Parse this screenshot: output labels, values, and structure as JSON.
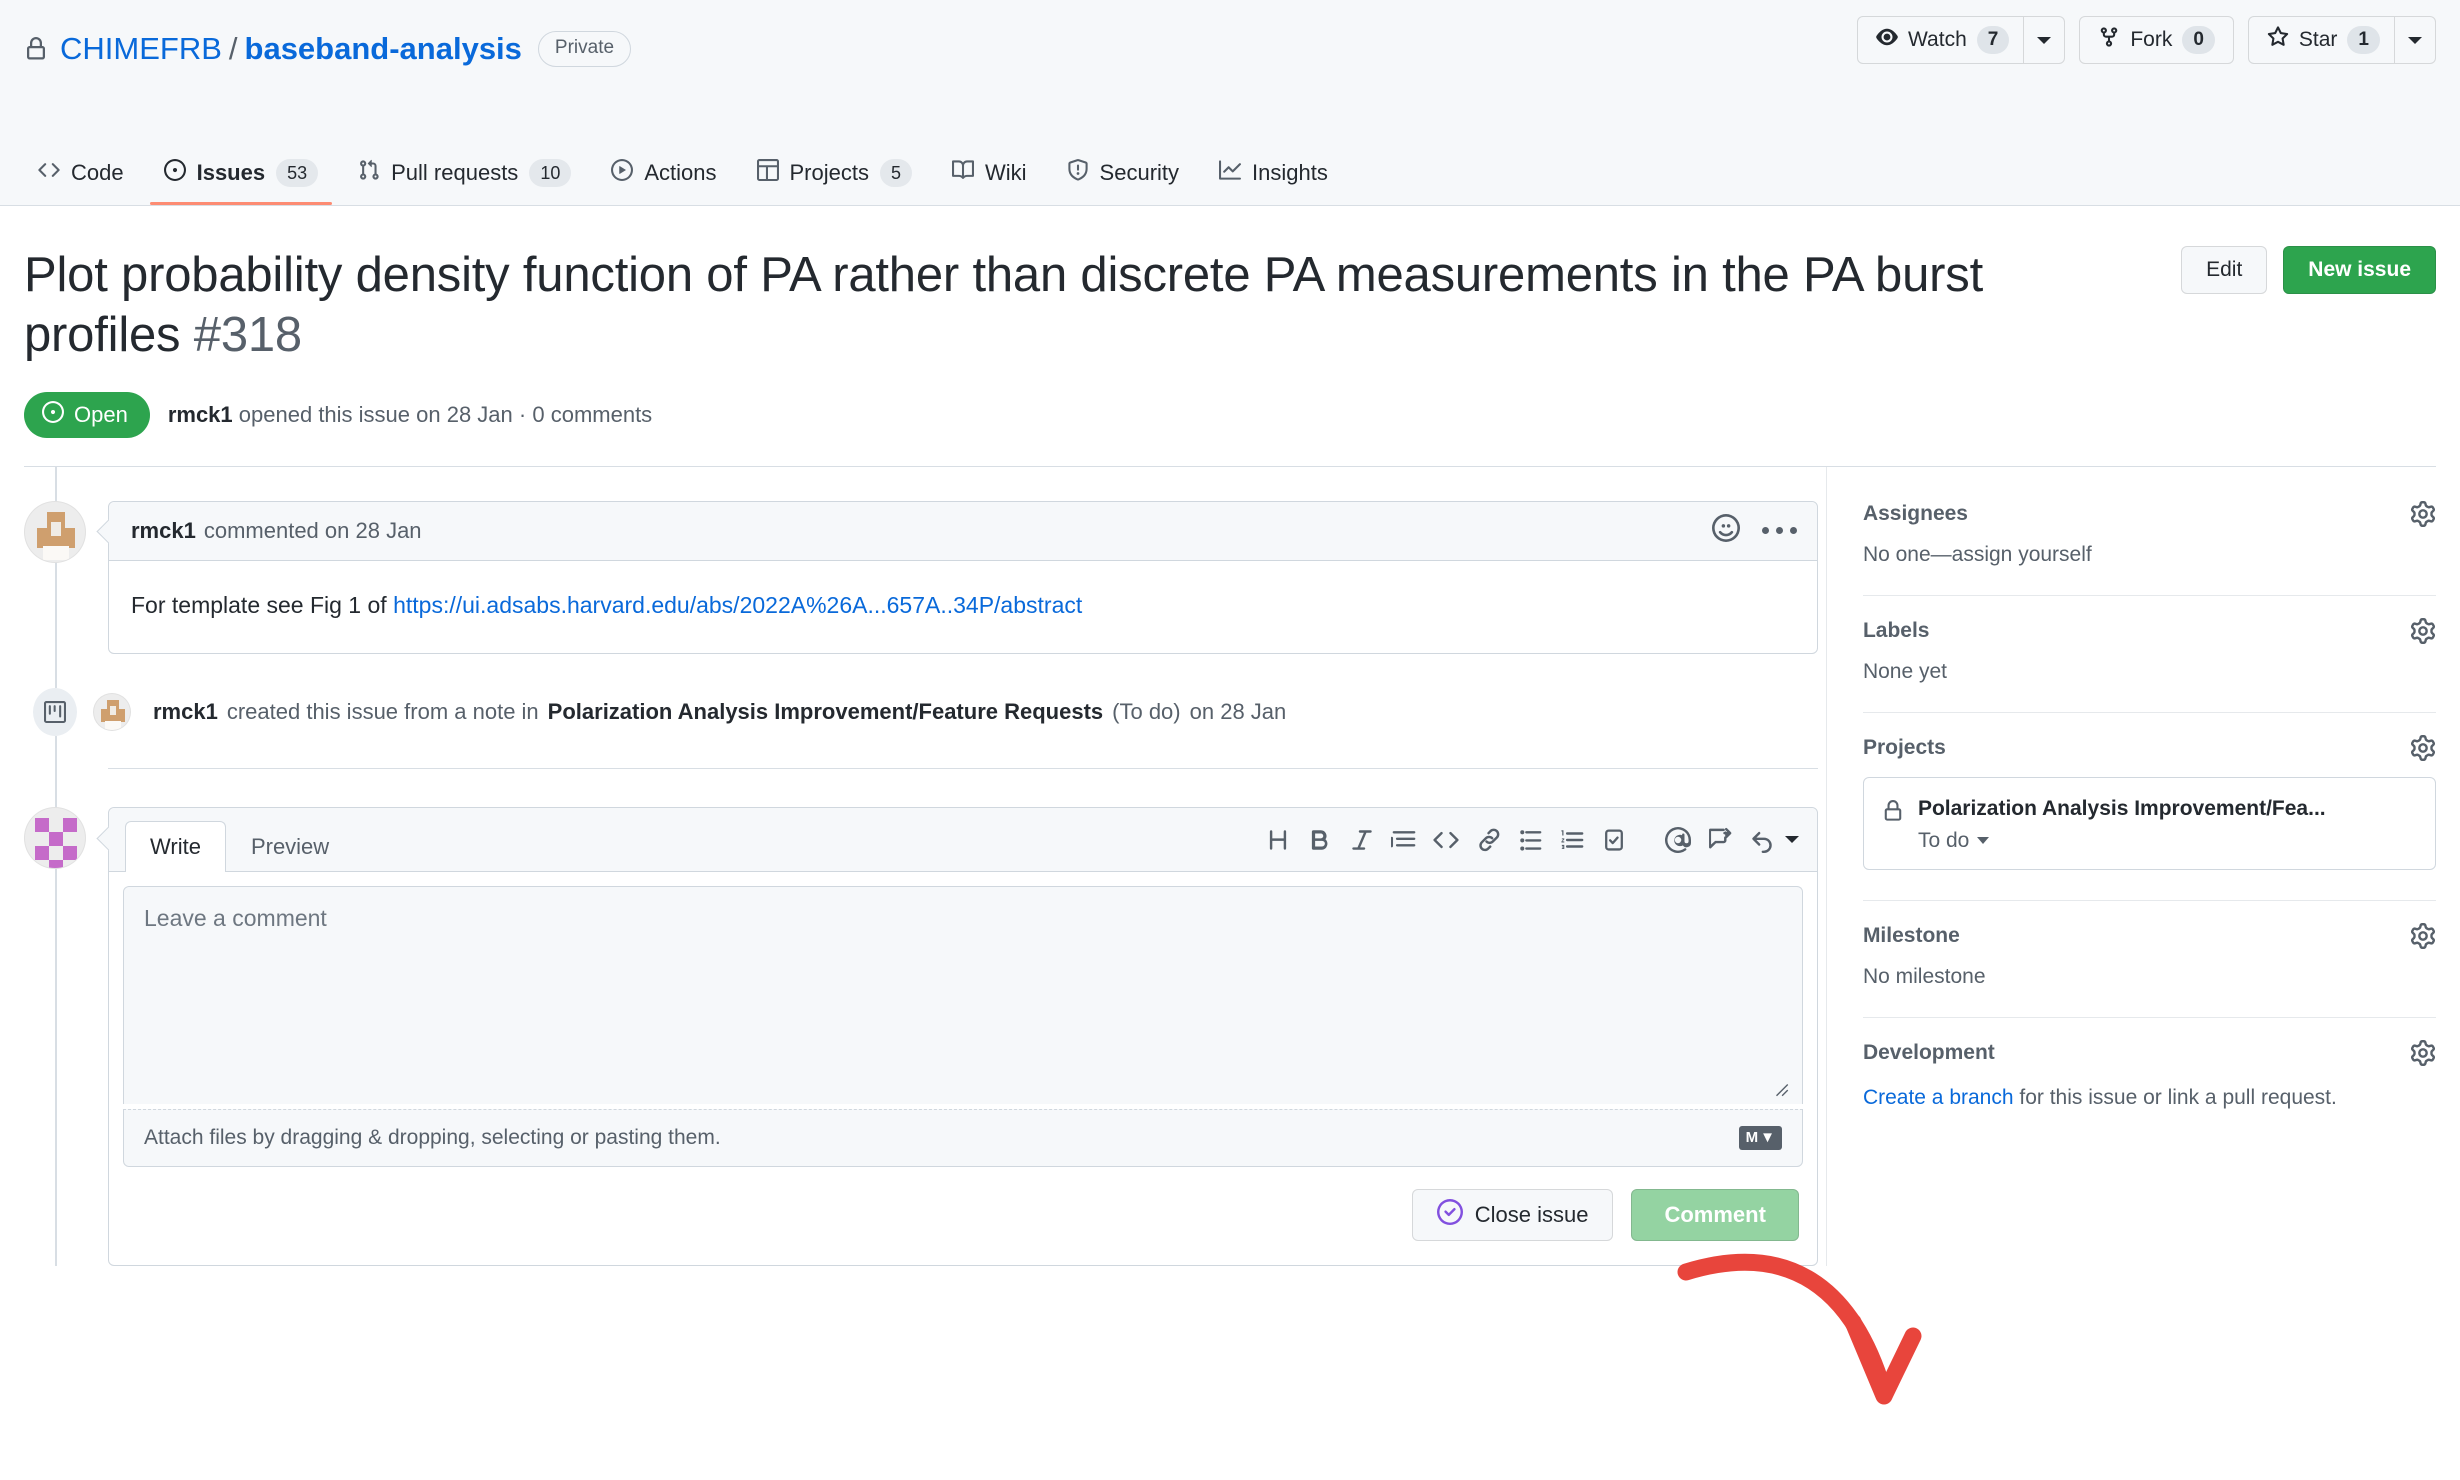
{
  "repo": {
    "owner": "CHIMEFRB",
    "separator": "/",
    "name": "baseband-analysis",
    "visibility": "Private",
    "lock_icon": "lock-icon"
  },
  "repo_actions": {
    "watch": {
      "label": "Watch",
      "count": "7",
      "icon": "eye-icon"
    },
    "fork": {
      "label": "Fork",
      "count": "0",
      "icon": "repo-forked-icon"
    },
    "star": {
      "label": "Star",
      "count": "1",
      "icon": "star-icon"
    }
  },
  "nav": [
    {
      "label": "Code",
      "icon": "code-icon",
      "counter": "",
      "selected": false
    },
    {
      "label": "Issues",
      "icon": "issue-opened-icon",
      "counter": "53",
      "selected": true
    },
    {
      "label": "Pull requests",
      "icon": "git-pull-request-icon",
      "counter": "10",
      "selected": false
    },
    {
      "label": "Actions",
      "icon": "play-icon",
      "counter": "",
      "selected": false
    },
    {
      "label": "Projects",
      "icon": "table-icon",
      "counter": "5",
      "selected": false
    },
    {
      "label": "Wiki",
      "icon": "book-icon",
      "counter": "",
      "selected": false
    },
    {
      "label": "Security",
      "icon": "shield-icon",
      "counter": "",
      "selected": false
    },
    {
      "label": "Insights",
      "icon": "graph-icon",
      "counter": "",
      "selected": false
    }
  ],
  "issue": {
    "title": "Plot probability density function of PA rather than discrete PA measurements in the PA burst profiles",
    "number": "#318",
    "edit_label": "Edit",
    "new_issue_label": "New issue",
    "state": "Open",
    "state_icon": "issue-opened-icon",
    "author": "rmck1",
    "meta_opened": "opened this issue on 28 Jan",
    "meta_separator": "·",
    "meta_comments": "0 comments"
  },
  "comment": {
    "author": "rmck1",
    "action": "commented on 28 Jan",
    "body_prefix": "For template see Fig 1 of ",
    "body_link": "https://ui.adsabs.harvard.edu/abs/2022A%26A...657A..34P/abstract",
    "reaction_icon": "smiley-icon",
    "menu_icon": "kebab-horizontal-icon"
  },
  "timeline_event": {
    "icon": "project-icon",
    "author": "rmck1",
    "text_before": "created this issue from a note in",
    "project": "Polarization Analysis Improvement/Feature Requests",
    "column": "(To do)",
    "date": "on 28 Jan"
  },
  "form": {
    "tabs": [
      {
        "label": "Write",
        "active": true
      },
      {
        "label": "Preview",
        "active": false
      }
    ],
    "toolbar": [
      {
        "name": "heading-icon",
        "glyph": "H"
      },
      {
        "name": "bold-icon",
        "glyph": "B"
      },
      {
        "name": "italic-icon",
        "glyph": "I"
      },
      {
        "name": "quote-icon",
        "glyph": ""
      },
      {
        "name": "code-icon",
        "glyph": ""
      },
      {
        "name": "link-icon",
        "glyph": ""
      },
      {
        "name": "unordered-list-icon",
        "glyph": ""
      },
      {
        "name": "ordered-list-icon",
        "glyph": ""
      },
      {
        "name": "task-list-icon",
        "glyph": ""
      },
      {
        "name": "mention-icon",
        "glyph": "@"
      },
      {
        "name": "cross-reference-icon",
        "glyph": ""
      },
      {
        "name": "reply-icon",
        "glyph": ""
      }
    ],
    "textarea_placeholder": "Leave a comment",
    "textarea_value": "",
    "attach_text": "Attach files by dragging & dropping, selecting or pasting them.",
    "markdown_badge": "M",
    "resize_grip_icon": "resize-grip-icon",
    "close_issue_label": "Close issue",
    "close_issue_icon": "issue-closed-icon",
    "comment_label": "Comment",
    "comment_disabled": true
  },
  "sidebar": {
    "assignees": {
      "title": "Assignees",
      "value": "No one—assign yourself",
      "gear": "gear-icon"
    },
    "labels": {
      "title": "Labels",
      "value": "None yet",
      "gear": "gear-icon"
    },
    "projects": {
      "title": "Projects",
      "gear": "gear-icon",
      "card": {
        "icon": "lock-icon",
        "name": "Polarization Analysis Improvement/Fea...",
        "status": "To do"
      }
    },
    "milestone": {
      "title": "Milestone",
      "value": "No milestone",
      "gear": "gear-icon"
    },
    "development": {
      "title": "Development",
      "gear": "gear-icon",
      "link": "Create a branch",
      "text": " for this issue or link a pull request."
    }
  },
  "annotation": {
    "type": "red-arrow",
    "color": "#e8453c",
    "points_to": "Create a branch"
  },
  "colors": {
    "accent": "#0969da",
    "open_green": "#2da44e",
    "tab_underline": "#fd8c73",
    "header_bg": "#f6f8fa",
    "border": "#d0d7de",
    "annotation_red": "#e8453c"
  }
}
